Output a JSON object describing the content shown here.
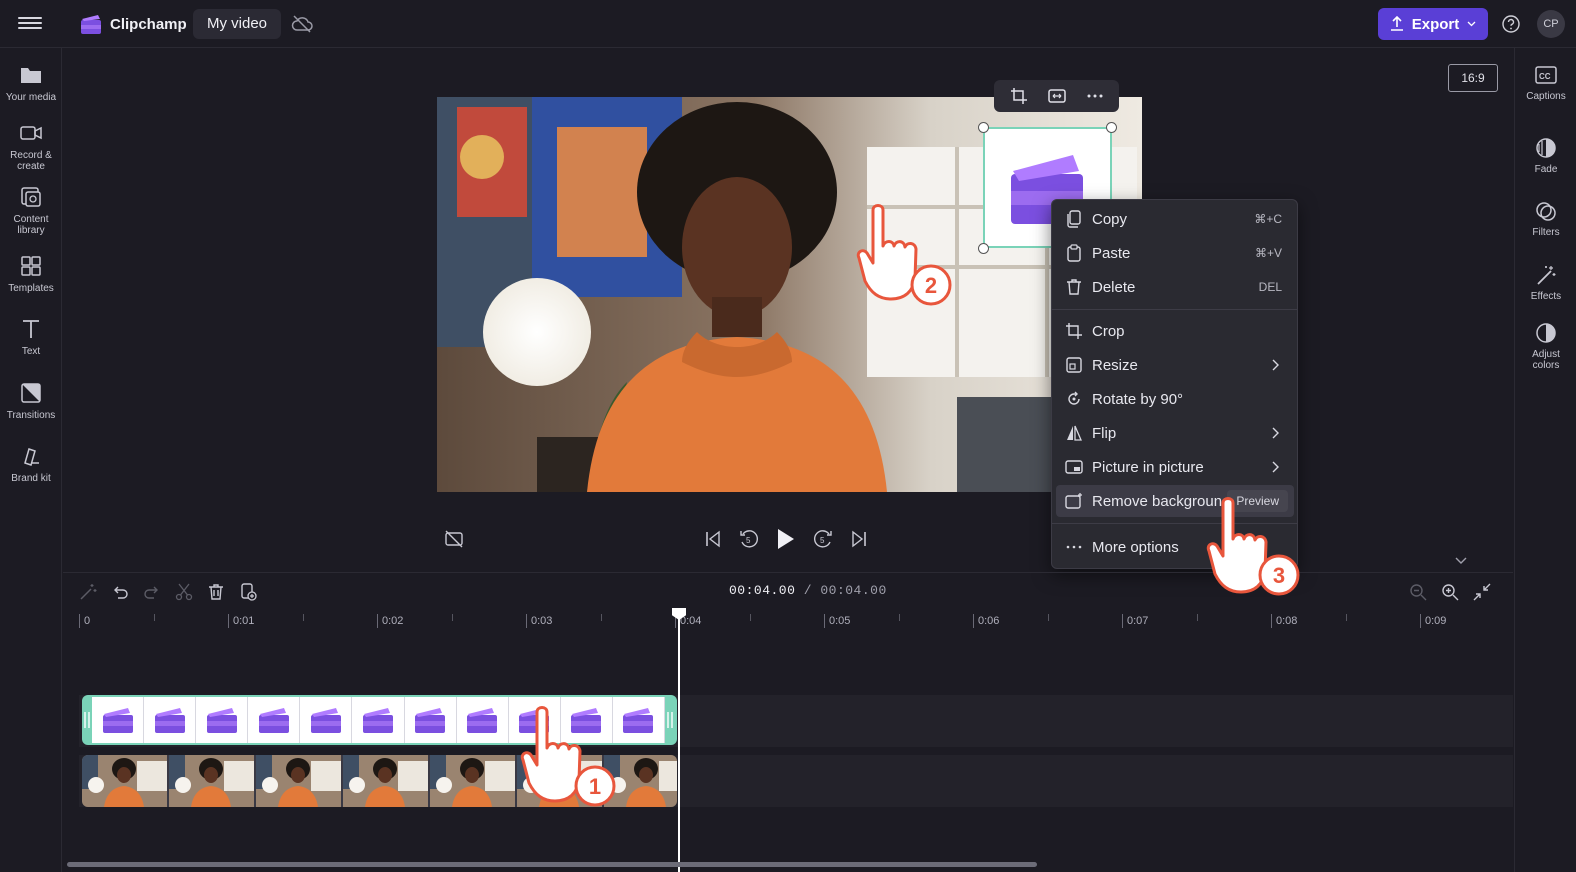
{
  "app": {
    "name": "Clipchamp",
    "video_title": "My video",
    "export_label": "Export",
    "avatar_initials": "CP"
  },
  "left_sidebar": {
    "items": [
      {
        "label": "Your media",
        "icon": "folder-icon"
      },
      {
        "label": "Record & create",
        "icon": "camera-icon"
      },
      {
        "label": "Content library",
        "icon": "library-icon"
      },
      {
        "label": "Templates",
        "icon": "templates-icon"
      },
      {
        "label": "Text",
        "icon": "text-icon"
      },
      {
        "label": "Transitions",
        "icon": "transitions-icon"
      },
      {
        "label": "Brand kit",
        "icon": "brand-kit-icon"
      }
    ]
  },
  "right_sidebar": {
    "items": [
      {
        "label": "Captions",
        "icon": "captions-icon"
      },
      {
        "label": "Fade",
        "icon": "fade-icon"
      },
      {
        "label": "Filters",
        "icon": "filters-icon"
      },
      {
        "label": "Effects",
        "icon": "effects-icon"
      },
      {
        "label": "Adjust colors",
        "icon": "adjust-colors-icon"
      }
    ]
  },
  "preview": {
    "aspect_ratio": "16:9"
  },
  "context_menu": {
    "items": [
      {
        "label": "Copy",
        "shortcut": "⌘+C"
      },
      {
        "label": "Paste",
        "shortcut": "⌘+V"
      },
      {
        "label": "Delete",
        "shortcut": "DEL"
      },
      {
        "label": "Crop"
      },
      {
        "label": "Resize"
      },
      {
        "label": "Rotate by 90°"
      },
      {
        "label": "Flip"
      },
      {
        "label": "Picture in picture"
      },
      {
        "label": "Remove background",
        "badge": "Preview"
      },
      {
        "label": "More options"
      }
    ]
  },
  "timeline": {
    "current_time": "00:04.00",
    "total_time": "/ 00:04.00",
    "ruler_labels": [
      "0",
      "0:01",
      "0:02",
      "0:03",
      "0:04",
      "0:05",
      "0:06",
      "0:07",
      "0:08",
      "0:09"
    ]
  },
  "steps": [
    "1",
    "2",
    "3"
  ],
  "colors": {
    "accent": "#5a3fd6",
    "selection": "#7ad3b8",
    "background": "#1c1b23",
    "step_badge": "#e8563c"
  }
}
